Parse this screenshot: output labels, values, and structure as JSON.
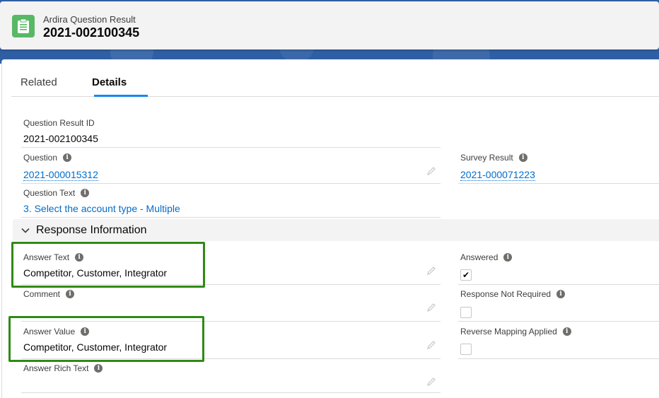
{
  "header": {
    "object_type": "Ardira Question Result",
    "record_name": "2021-002100345",
    "icon": "clipboard-icon"
  },
  "tabs": [
    {
      "label": "Related",
      "active": false
    },
    {
      "label": "Details",
      "active": true
    }
  ],
  "fields": {
    "question_result_id": {
      "label": "Question Result ID",
      "value": "2021-002100345"
    },
    "question": {
      "label": "Question",
      "value": "2021-000015312"
    },
    "survey_result": {
      "label": "Survey Result",
      "value": "2021-000071223"
    },
    "question_text": {
      "label": "Question Text",
      "value": "3. Select the account type - Multiple"
    }
  },
  "section": {
    "title": "Response Information",
    "fields": {
      "answer_text": {
        "label": "Answer Text",
        "value": "Competitor, Customer, Integrator"
      },
      "answered": {
        "label": "Answered",
        "checked": true
      },
      "comment": {
        "label": "Comment",
        "value": ""
      },
      "response_not_required": {
        "label": "Response Not Required",
        "checked": false
      },
      "answer_value": {
        "label": "Answer Value",
        "value": "Competitor, Customer, Integrator"
      },
      "reverse_mapping_applied": {
        "label": "Reverse Mapping Applied",
        "checked": false
      },
      "answer_rich_text": {
        "label": "Answer Rich Text",
        "value": ""
      }
    }
  },
  "colors": {
    "brand_band": "#2f5fa3",
    "icon_green": "#58b865",
    "link": "#006dcc",
    "tab_accent": "#1589ee",
    "highlight_green": "#2e8b14"
  }
}
